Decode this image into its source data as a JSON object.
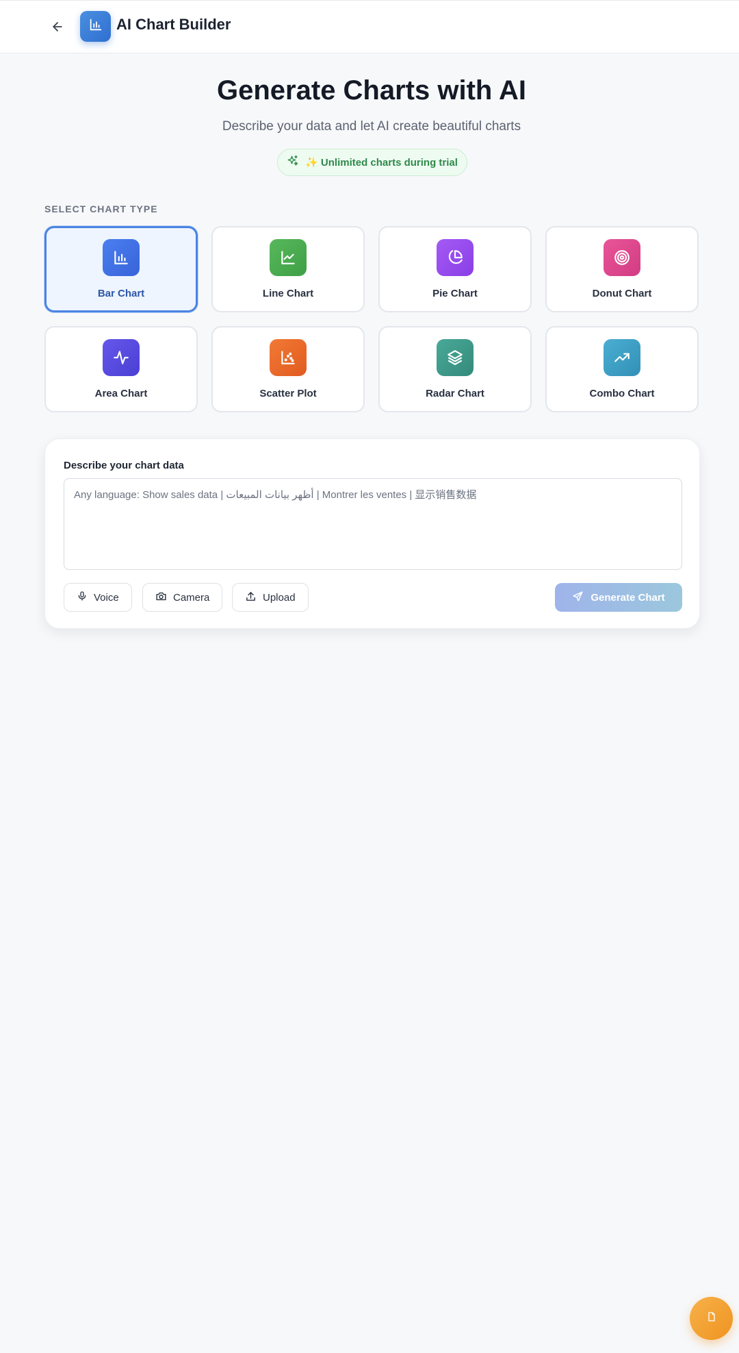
{
  "header": {
    "title": "AI Chart Builder",
    "back_icon": "arrow-left-icon",
    "logo_icon": "bar-chart-icon"
  },
  "hero": {
    "title": "Generate Charts with AI",
    "subtitle": "Describe your data and let AI create beautiful charts",
    "badge": "✨ Unlimited charts during trial",
    "badge_icon": "sparkles-icon"
  },
  "chart_types": {
    "section_label": "SELECT CHART TYPE",
    "selected": "Bar Chart",
    "items": [
      {
        "label": "Bar Chart",
        "icon": "bar-chart-icon",
        "color": "#3f6fe3"
      },
      {
        "label": "Line Chart",
        "icon": "line-chart-icon",
        "color": "#4caf50"
      },
      {
        "label": "Pie Chart",
        "icon": "pie-chart-icon",
        "color": "#9b4df0"
      },
      {
        "label": "Donut Chart",
        "icon": "target-icon",
        "color": "#e0488f"
      },
      {
        "label": "Area Chart",
        "icon": "activity-icon",
        "color": "#5a4fdf"
      },
      {
        "label": "Scatter Plot",
        "icon": "scatter-icon",
        "color": "#ee6a2a"
      },
      {
        "label": "Radar Chart",
        "icon": "layers-icon",
        "color": "#3f9e8f"
      },
      {
        "label": "Combo Chart",
        "icon": "trending-up-icon",
        "color": "#3f9fc4"
      }
    ]
  },
  "prompt": {
    "label": "Describe your chart data",
    "placeholder": "Any language: Show sales data | أظهر بيانات المبيعات | Montrer les ventes | 显示销售数据",
    "voice_label": "Voice",
    "camera_label": "Camera",
    "upload_label": "Upload",
    "generate_label": "Generate Chart"
  },
  "fab": {
    "icon": "document-icon"
  },
  "colors": {
    "accent": "#4a84e2",
    "background": "#f7f8fa",
    "badge_green": "#2f8a4a",
    "fab_orange": "#f7a23a"
  }
}
